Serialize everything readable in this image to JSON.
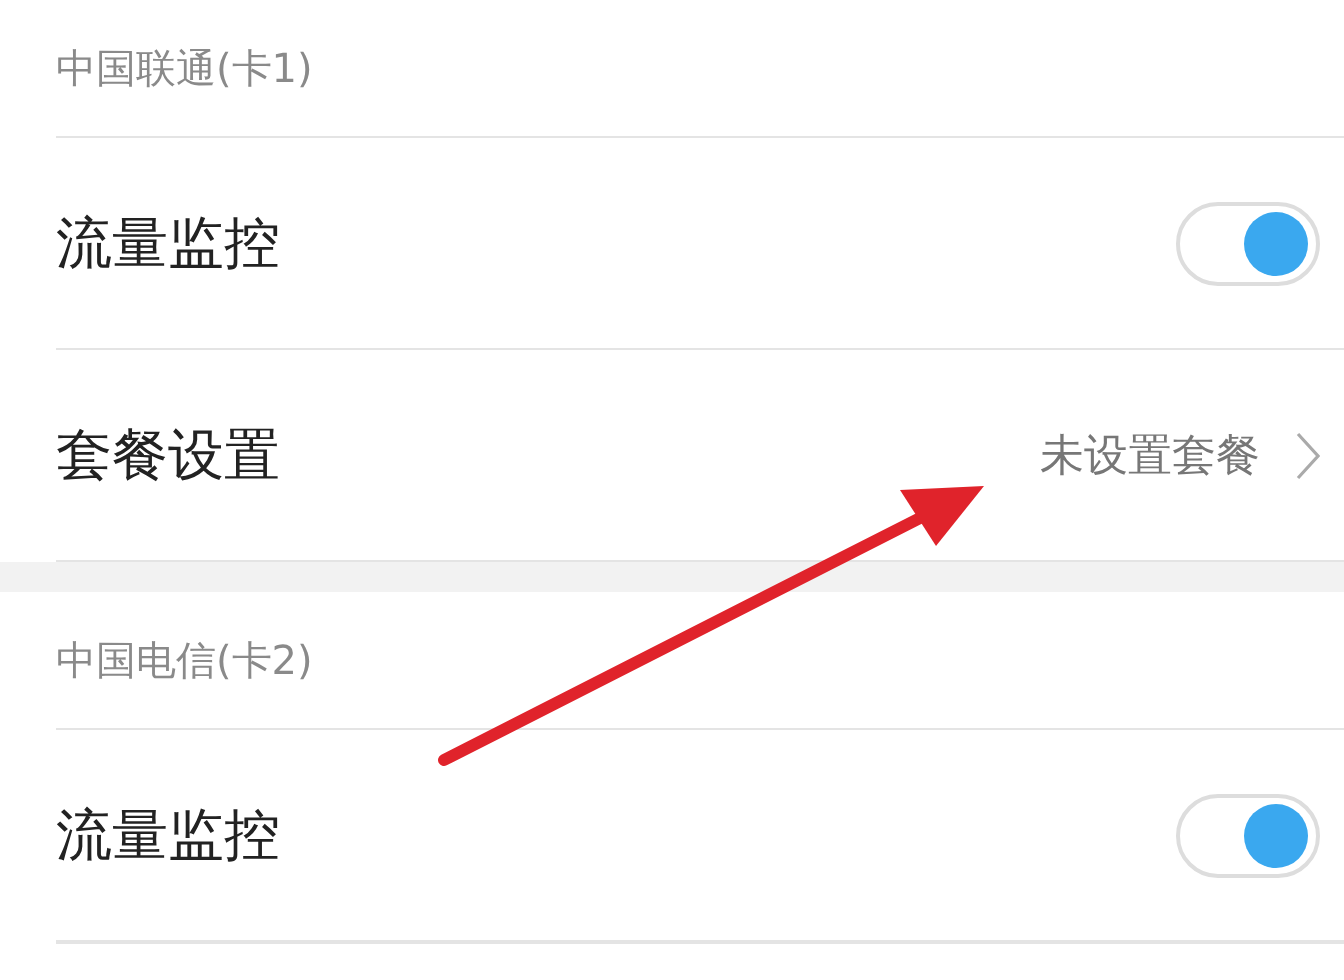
{
  "sections": [
    {
      "title": "中国联通(卡1)",
      "rows": [
        {
          "kind": "toggle",
          "label": "流量监控",
          "on": true
        },
        {
          "kind": "link",
          "label": "套餐设置",
          "value": "未设置套餐"
        }
      ]
    },
    {
      "title": "中国电信(卡2)",
      "rows": [
        {
          "kind": "toggle",
          "label": "流量监控",
          "on": true
        }
      ]
    }
  ],
  "annotations": [
    {
      "kind": "arrow"
    }
  ]
}
